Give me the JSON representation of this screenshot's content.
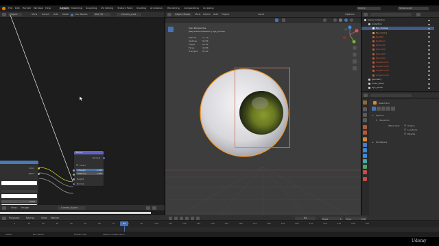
{
  "menubar": {
    "items": [
      "File",
      "Edit",
      "Render",
      "Window",
      "Help"
    ],
    "workspaces": [
      "Layout",
      "Modeling",
      "Sculpting",
      "UV Editing",
      "Texture Paint",
      "Shading",
      "Animation",
      "Rendering",
      "Compositing",
      "Scripting"
    ],
    "active_workspace": "Layout",
    "scene": "Scene",
    "view_layer": "View Layer"
  },
  "node_editor": {
    "header_items": [
      "Object",
      "View",
      "Select",
      "Add",
      "Node"
    ],
    "use_nodes": "Use Nodes",
    "slot": "Slot 10",
    "material": "Cornea_mat",
    "image_node": {
      "outputs": [
        "Color",
        "Alpha"
      ],
      "fields": [
        "RGB",
        "Linear",
        "Flat",
        "Repeat"
      ],
      "bottom_value": "0.500"
    },
    "bump_node": {
      "title": "Bump",
      "output": "Normal",
      "invert_label": "Invert",
      "strength_label": "Strength",
      "strength_value": "0.100",
      "distance_label": "Distance",
      "distance_value": "1.000",
      "inputs": [
        "Height",
        "Normal"
      ]
    }
  },
  "image_editor": {
    "header_items": [
      "View",
      "Image"
    ],
    "image_name": "Cornea_Alpha"
  },
  "viewport": {
    "mode": "Object Mode",
    "header_items": [
      "View",
      "Select",
      "Add",
      "Object"
    ],
    "transform": "Local",
    "options": "Options",
    "view_name": "User Perspective",
    "collection_path": "(84) Scene Collection | Eye_Cornea",
    "stats": [
      {
        "label": "Objects",
        "value": "1 / 14"
      },
      {
        "label": "Vertices",
        "value": "8,236"
      },
      {
        "label": "Edges",
        "value": "8,192"
      },
      {
        "label": "Faces",
        "value": "4,096"
      },
      {
        "label": "Triangles",
        "value": "8,192"
      }
    ]
  },
  "outliner": {
    "rows": [
      {
        "label": "Scene Collection",
        "indent": 0,
        "color": "#cccccc",
        "selected": false
      },
      {
        "label": "Collection",
        "indent": 1,
        "color": "#cccccc",
        "selected": false
      },
      {
        "label": "Eye_Cornea",
        "indent": 2,
        "color": "#ffffff",
        "selected": true
      },
      {
        "label": "Eye_Sclera",
        "indent": 2,
        "color": "#e0a35a",
        "selected": false
      },
      {
        "label": "EyeBall",
        "indent": 2,
        "color": "#d05a3a",
        "selected": false
      },
      {
        "label": "EyeBlood",
        "indent": 2,
        "color": "#d05a3a",
        "selected": false
      },
      {
        "label": "EyeLid01",
        "indent": 2,
        "color": "#d05a3a",
        "selected": false
      },
      {
        "label": "EyeLid02",
        "indent": 2,
        "color": "#d05a3a",
        "selected": false
      },
      {
        "label": "EyeLid03",
        "indent": 2,
        "color": "#d05a3a",
        "selected": false
      },
      {
        "label": "EyeLid04",
        "indent": 2,
        "color": "#d05a3a",
        "selected": false
      },
      {
        "label": "AngleCorr01",
        "indent": 2,
        "color": "#d05a3a",
        "selected": false
      },
      {
        "label": "AngleCorr02",
        "indent": 2,
        "color": "#d05a3a",
        "selected": false
      },
      {
        "label": "AngleCorr03",
        "indent": 2,
        "color": "#d05a3a",
        "selected": false
      },
      {
        "label": "AngleCorr04",
        "indent": 2,
        "color": "#d05a3a",
        "selected": false
      },
      {
        "label": "geometry",
        "indent": 1,
        "color": "#cccccc",
        "selected": false
      },
      {
        "label": "Close_Wrap",
        "indent": 1,
        "color": "#cccccc",
        "selected": false
      },
      {
        "label": "Eye_Model",
        "indent": 1,
        "color": "#cccccc",
        "selected": false
      }
    ]
  },
  "properties": {
    "select_box": "Select Box",
    "options": "Options",
    "transform": "Transform",
    "affect_only": "Affect Only",
    "checkboxes": [
      "Origins",
      "Locations",
      "Parents"
    ],
    "workspace": "Workspace"
  },
  "timeline": {
    "header_items": [
      "Playback",
      "Keying",
      "View",
      "Marker"
    ],
    "current_frame": "84",
    "start_label": "Start",
    "start_value": "1",
    "end_label": "End",
    "end_value": "250",
    "ticks": [
      "0",
      "10",
      "20",
      "30",
      "40",
      "50",
      "60",
      "70",
      "80",
      "90",
      "100",
      "110",
      "120",
      "130",
      "140",
      "150",
      "160",
      "170",
      "180",
      "190",
      "200",
      "210",
      "220",
      "230",
      "240",
      "250"
    ]
  },
  "statusbar": {
    "items": [
      "Select",
      "Box Select",
      "Rotate View",
      "Object Context Menu"
    ],
    "watermark": "Udemy"
  },
  "colors": {
    "accent": "#4772b3",
    "active_object": "#ffa020",
    "bump_header": "#6363c7",
    "image_header": "#4b79b1",
    "frame_cursor": "#4772b3"
  }
}
